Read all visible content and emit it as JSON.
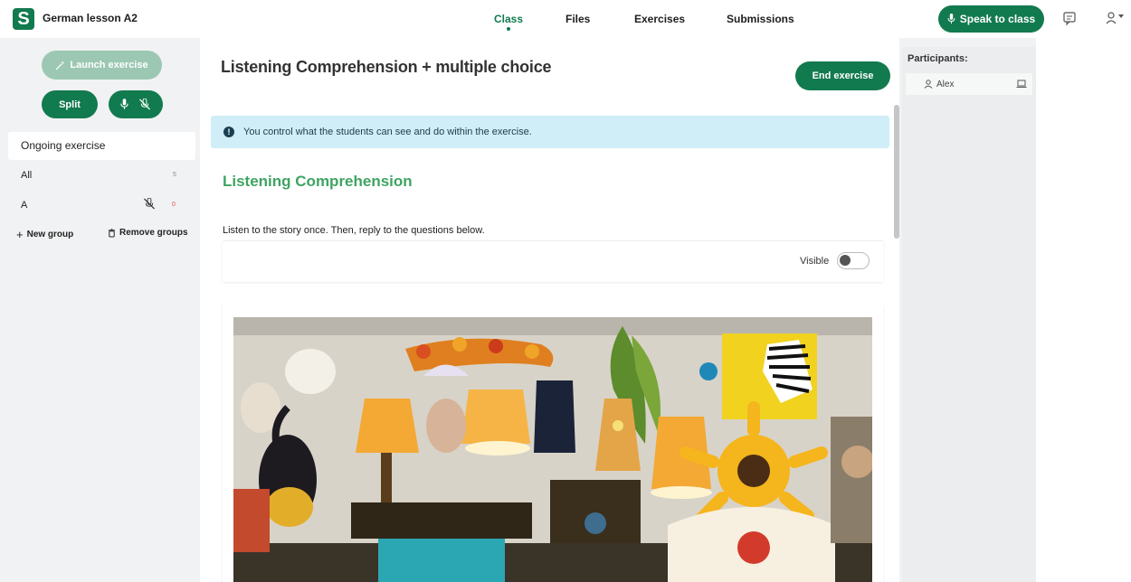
{
  "app": {
    "logo_letter": "S",
    "title": "German lesson A2"
  },
  "nav": {
    "tabs": [
      {
        "label": "Class",
        "active": true
      },
      {
        "label": "Files"
      },
      {
        "label": "Exercises"
      },
      {
        "label": "Submissions"
      }
    ],
    "speak_label": "Speak to class"
  },
  "sidebar": {
    "launch_label": "Launch exercise",
    "split_label": "Split",
    "groups": [
      {
        "label": "Ongoing exercise",
        "active": true
      },
      {
        "label": "All",
        "count": "5"
      },
      {
        "label": "A",
        "count": "0"
      }
    ],
    "new_group_label": "New group",
    "remove_groups_label": "Remove groups"
  },
  "main": {
    "title": "Listening Comprehension + multiple choice",
    "end_label": "End exercise",
    "info_text": "You control what the students can see and do within the exercise.",
    "section_title": "Listening Comprehension",
    "instruction": "Listen to the story once. Then, reply to the questions below.",
    "visible_label": "Visible",
    "visible_on": false
  },
  "participants": {
    "title": "Participants:",
    "items": [
      {
        "name": "Alex"
      }
    ]
  },
  "colors": {
    "brand": "#127a4f",
    "section_green": "#3fa462",
    "info_bg": "#cfeef8"
  }
}
